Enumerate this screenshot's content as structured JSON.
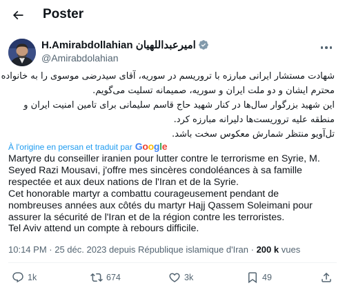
{
  "header": {
    "title": "Poster"
  },
  "author": {
    "name": "H.Amirabdollahian امیرعبداللهیان",
    "handle": "@Amirabdolahian"
  },
  "post": {
    "text_fa_lines": [
      "شهادت مستشار ایرانی مبارزه با تروریسم در سوریه، آقای سیدرضی موسوی را به خانواده",
      "محترم ایشان و دو ملت ایران و سوریه، صمیمانه تسلیت می‌گویم.",
      "این شهید بزرگوار سال‌ها در کنار شهید حاج قاسم سلیمانی برای تامین امنیت ایران و",
      "منطقه علیه تروریست‌ها دلیرانه مبارزه کرد.",
      "تل‌آویو منتظر شمارش معکوس سخت باشد."
    ],
    "translation_note": "À l'origine en persan et traduit par",
    "translator": "Google",
    "text_fr_lines": [
      "Martyre du conseiller iranien pour lutter contre le terrorisme en Syrie, M.",
      "Seyed Razi Mousavi, j'offre mes sincères condoléances à sa famille",
      "respectée et aux deux nations de l'Iran et de la Syrie.",
      "Cet honorable martyr a combattu courageusement pendant de",
      "nombreuses années aux côtés du martyr Hajj Qassem Soleimani pour",
      "assurer la sécurité de l'Iran et de la région contre les terroristes.",
      "Tel Aviv attend un compte à rebours difficile."
    ],
    "time": "10:14 PM",
    "date": "25 déc. 2023",
    "location": "depuis République islamique d'Iran",
    "views_count": "200 k",
    "views_label": "vues"
  },
  "actions": {
    "replies": "1k",
    "reposts": "674",
    "likes": "3k",
    "bookmarks": "49"
  },
  "colors": {
    "accent": "#1d9bf0",
    "secondary_text": "#536471",
    "verified": "#829aab"
  },
  "icons": [
    "back-arrow-icon",
    "verified-badge-icon",
    "more-icon",
    "reply-icon",
    "repost-icon",
    "like-icon",
    "bookmark-icon",
    "share-icon"
  ]
}
